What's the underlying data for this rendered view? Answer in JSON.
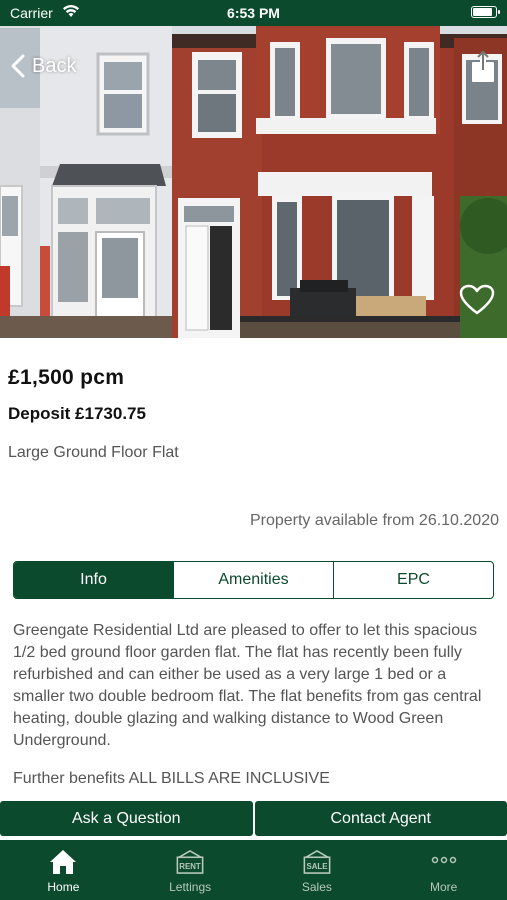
{
  "status_bar": {
    "carrier": "Carrier",
    "time": "6:53 PM"
  },
  "hero": {
    "back_label": "Back",
    "icons": {
      "back": "chevron-left-icon",
      "share": "share-icon",
      "favourite": "heart-outline-icon"
    }
  },
  "listing": {
    "price": "£1,500 pcm",
    "deposit": "Deposit £1730.75",
    "subtitle": "Large Ground Floor Flat",
    "availability": "Property available from 26.10.2020"
  },
  "tabs": [
    {
      "label": "Info",
      "active": true
    },
    {
      "label": "Amenities",
      "active": false
    },
    {
      "label": "EPC",
      "active": false
    }
  ],
  "description": {
    "paragraph1": "Greengate Residential Ltd are pleased to offer to let this spacious 1/2 bed ground floor garden flat.  The flat has recently been fully refurbished and can either be used as a very large 1 bed or a smaller two double bedroom flat.  The flat benefits from gas central heating, double glazing and walking distance to Wood Green Underground.",
    "paragraph2": "Further benefits ALL BILLS ARE INCLUSIVE"
  },
  "actions": {
    "ask": "Ask a Question",
    "contact": "Contact Agent"
  },
  "tab_bar": {
    "items": [
      {
        "label": "Home",
        "icon": "home-icon",
        "active": true
      },
      {
        "label": "Lettings",
        "icon": "rent-sign-icon",
        "badge": "RENT",
        "active": false
      },
      {
        "label": "Sales",
        "icon": "sale-sign-icon",
        "badge": "SALE",
        "active": false
      },
      {
        "label": "More",
        "icon": "more-dots-icon",
        "active": false
      }
    ]
  },
  "colors": {
    "brand_green": "#0b4a2c",
    "text_gray": "#555555"
  }
}
